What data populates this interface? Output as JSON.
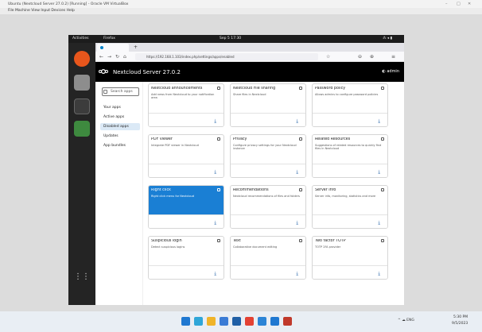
{
  "outer": {
    "title": "Ubuntu (Nextcloud Server 27.0.2) [Running] - Oracle VM VirtualBox",
    "menu": "File  Machine  View  Input  Devices  Help",
    "controls": [
      "–",
      "□",
      "✕"
    ]
  },
  "gnome": {
    "activities": "Activities",
    "app": "Firefox",
    "clock": "Sep 5  17:30",
    "status": "⁂ ◂ ▮"
  },
  "dock": [
    {
      "name": "firefox-icon",
      "color": "#e8561c"
    },
    {
      "name": "files-icon",
      "color": "#9c9c9c"
    },
    {
      "name": "terminal-icon",
      "color": "#3c3c3c"
    },
    {
      "name": "libreoffice-icon",
      "color": "#3e8a3f"
    },
    {
      "name": "apps-grid-icon",
      "color": "#242424"
    }
  ],
  "browser": {
    "url": "https://192.168.1.103/index.php/settings/apps/enabled",
    "new_tab": "+",
    "nav": [
      "←",
      "→",
      "↻",
      "⌂"
    ],
    "right_icons": [
      "☆",
      "⊖",
      "⊕",
      "≡"
    ]
  },
  "nextcloud": {
    "header_title": "Nextcloud Server 27.0.2",
    "user": "◐ admin",
    "search_placeholder": "Search apps",
    "sidebar": [
      {
        "label": "Your apps",
        "active": false
      },
      {
        "label": "Active apps",
        "active": false
      },
      {
        "label": "Disabled apps",
        "active": true
      },
      {
        "label": "Updates",
        "active": false
      },
      {
        "label": "App bundles",
        "active": false
      }
    ],
    "cards": [
      {
        "title": "Nextcloud announcements",
        "desc": "Add news from Nextcloud to your notification area",
        "sel": false
      },
      {
        "title": "Nextcloud File sharing",
        "desc": "Share files in Nextcloud",
        "sel": false
      },
      {
        "title": "Password policy",
        "desc": "Allows admins to configure password policies",
        "sel": false
      },
      {
        "title": "PDF viewer",
        "desc": "Integrate PDF viewer in Nextcloud",
        "sel": false
      },
      {
        "title": "Privacy",
        "desc": "Configure privacy settings for your Nextcloud instance",
        "sel": false
      },
      {
        "title": "Related Resources",
        "desc": "Suggestions of related resources to quickly find files in Nextcloud",
        "sel": false
      },
      {
        "title": "Right click",
        "desc": "Right click menu for Nextcloud",
        "sel": true
      },
      {
        "title": "Recommendations",
        "desc": "Nextcloud recommendations of files and folders",
        "sel": false
      },
      {
        "title": "Server Info",
        "desc": "Server info, monitoring, statistics and more",
        "sel": false
      },
      {
        "title": "Suspicious login",
        "desc": "Detect suspicious logins",
        "sel": false
      },
      {
        "title": "Text",
        "desc": "Collaborative document editing",
        "sel": false
      },
      {
        "title": "Two factor TOTP",
        "desc": "TOTP 2FA provider",
        "sel": false
      }
    ],
    "download_glyph": "⤓"
  },
  "taskbar": {
    "icons": [
      {
        "name": "start-icon",
        "color": "#1f78d1"
      },
      {
        "name": "edge-icon",
        "color": "#2fa6d8"
      },
      {
        "name": "explorer-icon",
        "color": "#f0b429"
      },
      {
        "name": "store-icon",
        "color": "#3a7bd5"
      },
      {
        "name": "mail-icon",
        "color": "#1f5fa6"
      },
      {
        "name": "chrome-icon",
        "color": "#e34133"
      },
      {
        "name": "photos-icon",
        "color": "#2b84d6"
      },
      {
        "name": "defender-icon",
        "color": "#1f78d1"
      },
      {
        "name": "virtualbox-icon",
        "color": "#c0392b"
      }
    ],
    "tray_text": "^  ☁  ENG",
    "clock_time": "5:30 PM",
    "clock_date": "9/5/2023"
  }
}
